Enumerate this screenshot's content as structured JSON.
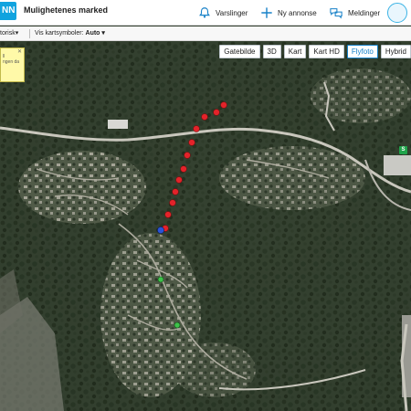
{
  "header": {
    "logo_text": "NN",
    "title": "Mulighetenes marked",
    "items": [
      {
        "label": "Varslinger",
        "icon": "bell-icon"
      },
      {
        "label": "Ny annonse",
        "icon": "plus-icon"
      },
      {
        "label": "Meldinger",
        "icon": "chat-bubbles-icon"
      }
    ],
    "avatar_icon": "user-avatar-icon",
    "accent": "#11a3df"
  },
  "toolbar": {
    "left_label": "torisk▾",
    "map_symbols_label": "Vis kartsymboler:",
    "map_symbols_value": "Auto ▾"
  },
  "popup": {
    "close": "✕",
    "line1": "ll",
    "line2": "ngen da"
  },
  "map_types": [
    {
      "label": "Gatebilde",
      "active": false
    },
    {
      "label": "3D",
      "active": false
    },
    {
      "label": "Kart",
      "active": false
    },
    {
      "label": "Kart HD",
      "active": false
    },
    {
      "label": "Flyfoto",
      "active": true
    },
    {
      "label": "Hybrid",
      "active": false
    }
  ],
  "poi_badge": "S",
  "markers": {
    "route_color": "#e3232a",
    "current_color": "#2a54d6",
    "green_color": "#3ec24a",
    "route_count": 13
  }
}
